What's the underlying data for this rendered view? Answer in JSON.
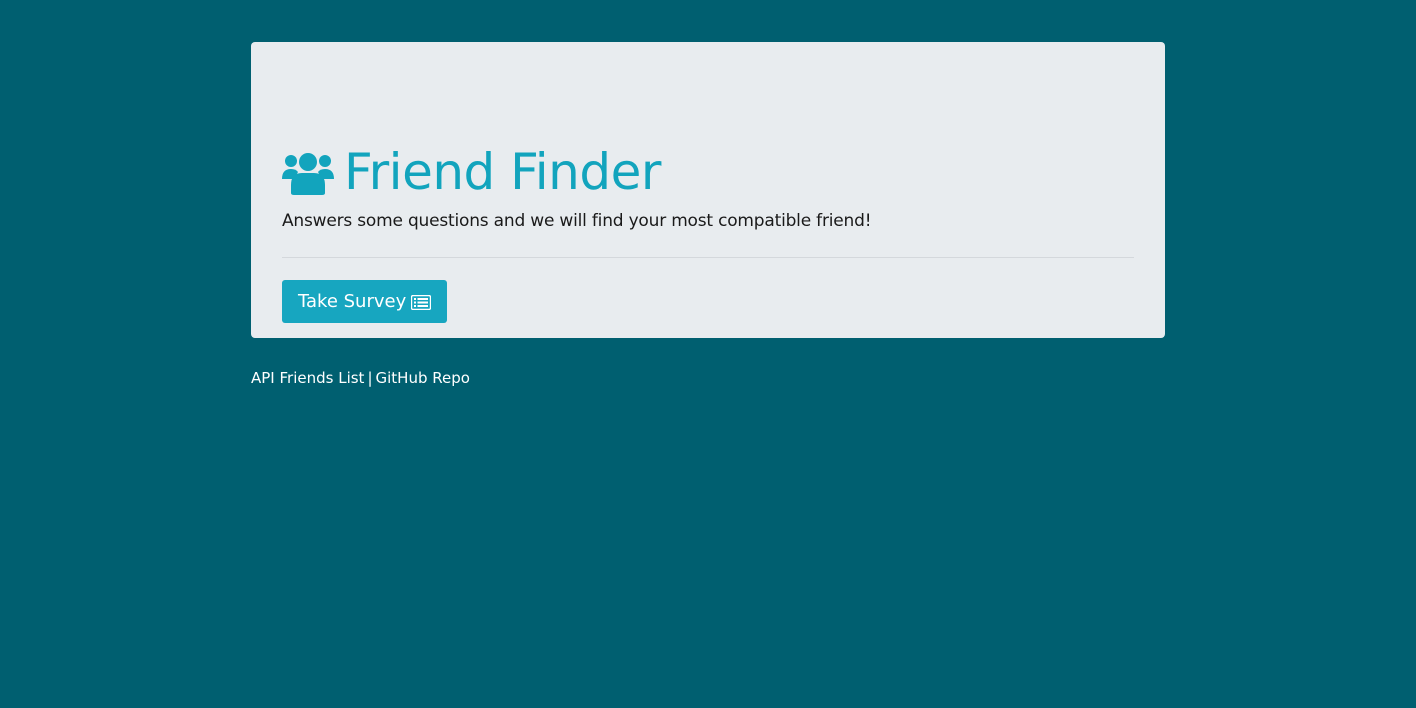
{
  "header": {
    "title": "Friend Finder",
    "icon": "users-icon",
    "subtitle": "Answers some questions and we will find your most compatible friend!"
  },
  "actions": {
    "survey_button_label": "Take Survey",
    "survey_button_icon": "list-alt-icon"
  },
  "footer": {
    "links": [
      {
        "label": "API Friends List"
      },
      {
        "label": "GitHub Repo"
      }
    ],
    "separator": "|"
  },
  "colors": {
    "page_background": "#005f70",
    "panel_background": "#e8ecef",
    "accent": "#12a4bd",
    "button_background": "#17a6c0"
  }
}
